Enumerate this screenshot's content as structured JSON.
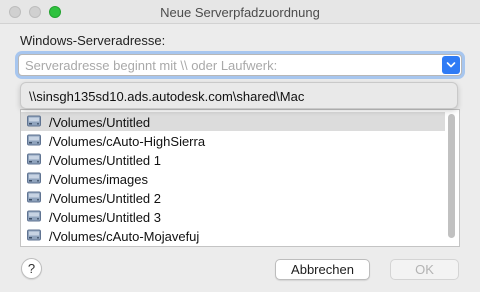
{
  "window": {
    "title": "Neue Serverpfadzuordnung"
  },
  "form": {
    "server_label": "Windows-Serveradresse:",
    "server_placeholder": "Serveradresse beginnt mit \\\\ oder Laufwerk:",
    "server_value": ""
  },
  "dropdown": {
    "items": [
      "\\\\sinsgh135sd10.ads.autodesk.com\\shared\\Mac"
    ]
  },
  "list": {
    "items": [
      "/Volumes/Untitled",
      "/Volumes/cAuto-HighSierra",
      "/Volumes/Untitled 1",
      "/Volumes/images",
      "/Volumes/Untitled 2",
      "/Volumes/Untitled 3",
      "/Volumes/cAuto-Mojavefuj"
    ],
    "selected_index": 0,
    "icon": "hard-drive-icon"
  },
  "buttons": {
    "help_label": "?",
    "cancel_label": "Abbrechen",
    "ok_label": "OK"
  },
  "colors": {
    "accent": "#2f7bf5",
    "focus_ring": "#a7c6ef",
    "selection": "#dcdcdc"
  }
}
